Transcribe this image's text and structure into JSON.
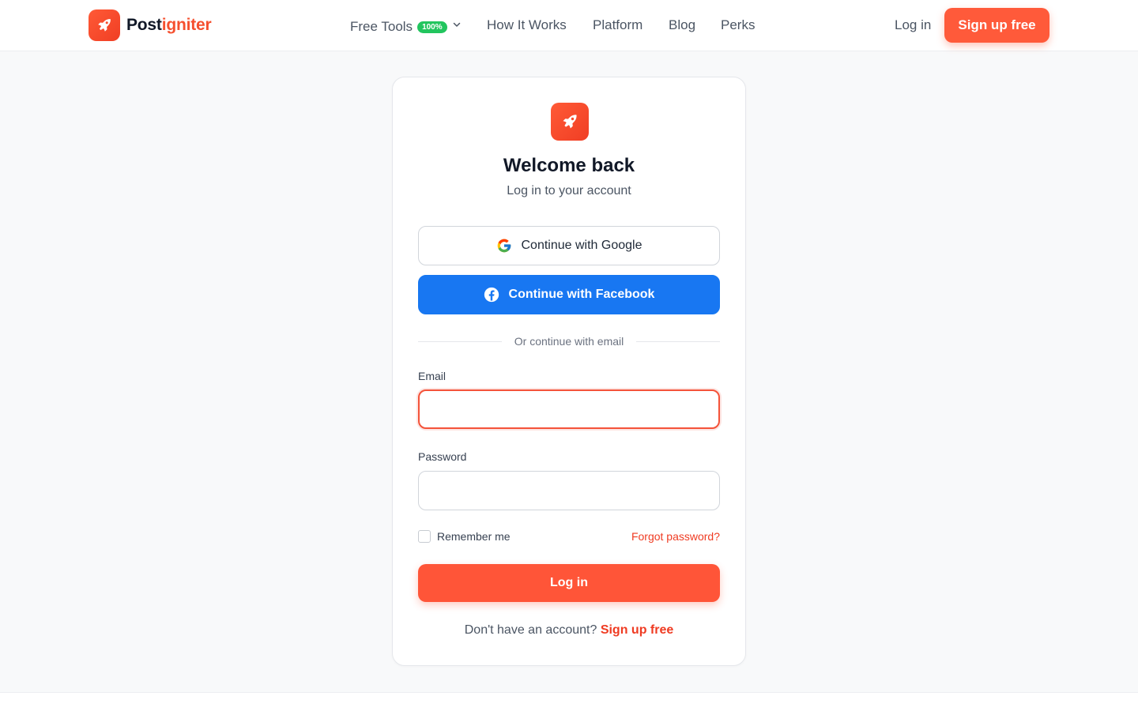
{
  "brand": {
    "name_part1": "Post",
    "name_part2": "igniter",
    "accent": "#ff5a3a"
  },
  "nav": {
    "free_tools": "Free Tools",
    "free_tools_badge": "100%",
    "how_it_works": "How It Works",
    "platform": "Platform",
    "blog": "Blog",
    "perks": "Perks",
    "login": "Log in",
    "signup": "Sign up free"
  },
  "card": {
    "title": "Welcome back",
    "subtitle": "Log in to your account",
    "google_label": "Continue with Google",
    "facebook_label": "Continue with Facebook",
    "divider_text": "Or continue with email",
    "email_label": "Email",
    "email_value": "",
    "password_label": "Password",
    "password_value": "",
    "remember_label": "Remember me",
    "forgot_label": "Forgot password?",
    "login_button": "Log in",
    "no_account_text": "Don't have an account?",
    "signup_link": "Sign up free"
  },
  "icons": {
    "logo": "rocket-icon",
    "dropdown": "chevron-down-icon",
    "google": "google-icon",
    "facebook": "facebook-icon"
  },
  "colors": {
    "facebook": "#1877f2",
    "badge": "#22c55e",
    "focus_border": "#f4533a"
  }
}
